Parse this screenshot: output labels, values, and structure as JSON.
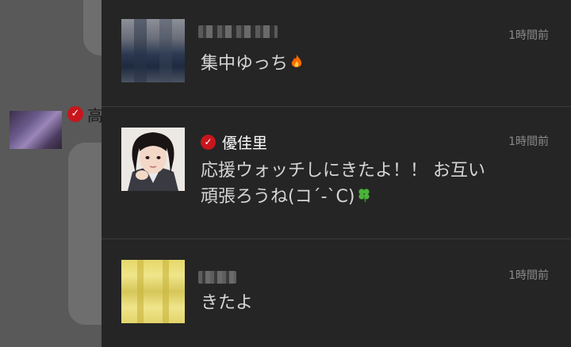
{
  "background_page": {
    "poster_name_fragment": "高"
  },
  "notifications": [
    {
      "name": "",
      "message": "集中ゆっち",
      "emoji_icon": "fire-emoji",
      "time": "1時間前",
      "verified": false
    },
    {
      "name": "優佳里",
      "message_line1": "応援ウォッチしにきたよ！！ お互い",
      "message_line2": "頑張ろうね(コ´-`С)",
      "emoji_icon": "four-leaf-clover-emoji",
      "time": "1時間前",
      "verified": true
    },
    {
      "name": "",
      "message": "きたよ",
      "time": "1時間前",
      "verified": false
    }
  ],
  "colors": {
    "panel_bg": "#252525",
    "verified_badge": "#c8161d",
    "time_text": "#8a8a8a"
  }
}
